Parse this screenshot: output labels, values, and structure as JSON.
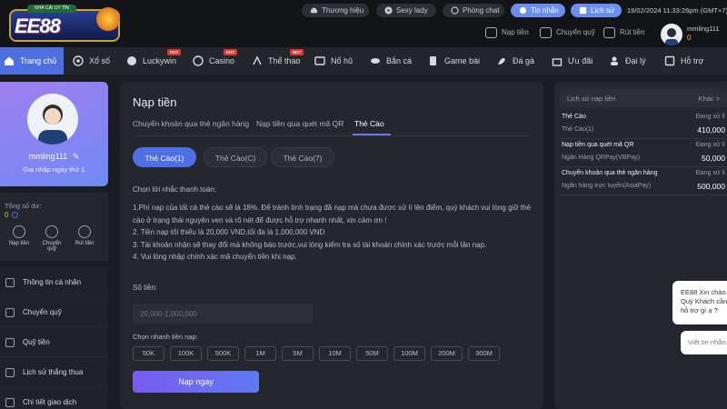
{
  "header": {
    "logo_text": "EE88",
    "logo_badge": "NHÀ CÁI UY TÍN",
    "pills": [
      {
        "label": "Thương hiệu",
        "icon": "car-icon"
      },
      {
        "label": "Sexy lady",
        "icon": "play-icon"
      },
      {
        "label": "Phòng chat",
        "icon": "chat-icon"
      },
      {
        "label": "Tin nhắn",
        "icon": "message-icon"
      },
      {
        "label": "Lịch sử",
        "icon": "history-icon"
      }
    ],
    "datetime": "19/02/2024 11:33:26pm (GMT+7)",
    "quick_actions": [
      {
        "label": "Nạp tiền",
        "icon": "deposit-icon"
      },
      {
        "label": "Chuyển quỹ",
        "icon": "wallet-icon"
      },
      {
        "label": "Rút tiền",
        "icon": "withdraw-icon"
      }
    ],
    "username": "mmling111",
    "balance": "0"
  },
  "nav": {
    "items": [
      {
        "label": "Trang chủ",
        "icon": "home-icon",
        "hot": false
      },
      {
        "label": "Xổ số",
        "icon": "lottery-icon",
        "hot": false
      },
      {
        "label": "Luckywin",
        "icon": "soccer-icon",
        "hot": true
      },
      {
        "label": "Casino",
        "icon": "casino-icon",
        "hot": true
      },
      {
        "label": "Thể thao",
        "icon": "sports-icon",
        "hot": true
      },
      {
        "label": "Nổ hũ",
        "icon": "slot-icon",
        "hot": false
      },
      {
        "label": "Bắn cá",
        "icon": "fish-icon",
        "hot": false
      },
      {
        "label": "Game bài",
        "icon": "cards-icon",
        "hot": false
      },
      {
        "label": "Đá gà",
        "icon": "rooster-icon",
        "hot": false
      },
      {
        "label": "Ưu đãi",
        "icon": "gift-icon",
        "hot": false
      },
      {
        "label": "Đại lý",
        "icon": "agent-icon",
        "hot": false
      },
      {
        "label": "Hỗ trợ",
        "icon": "support-icon",
        "hot": false
      }
    ],
    "hot_label": "HOT"
  },
  "sidebar": {
    "username": "mmling111",
    "rank": "Gia nhập ngày thứ 1",
    "wallet_label": "Tổng số dư:",
    "wallet_value": "0",
    "wallet_buttons": [
      {
        "label": "Nạp tiền",
        "icon": "deposit-icon"
      },
      {
        "label": "Chuyển quỹ",
        "icon": "wallet-icon"
      },
      {
        "label": "Rút tiền",
        "icon": "withdraw-icon"
      }
    ],
    "menu": [
      {
        "label": "Thông tin cá nhân",
        "icon": "user-icon"
      },
      {
        "label": "Chuyển quỹ",
        "icon": "transfer-icon"
      },
      {
        "label": "Quỹ tiền",
        "icon": "fund-icon"
      },
      {
        "label": "Lịch sử thắng thua",
        "icon": "chart-icon"
      },
      {
        "label": "Chi tiết giao dịch",
        "icon": "list-icon"
      }
    ]
  },
  "main": {
    "title": "Nạp tiền",
    "tabs": [
      {
        "label": "Chuyển khoản qua thẻ ngân hàng"
      },
      {
        "label": "Nạp tiền qua quét mã QR"
      },
      {
        "label": "Thẻ Cào"
      }
    ],
    "chips": [
      {
        "label": "Thẻ Cào(1)"
      },
      {
        "label": "Thẻ Cào(C)"
      },
      {
        "label": "Thẻ Cào(7)"
      }
    ],
    "notice_title": "Chọn lời nhắc thanh toán:",
    "notice_lines": [
      "1.Phí nạp của tất cả thẻ cào sẽ là 18%. Để tránh tình trạng đã nạp mà chưa được xử lí lên điểm, quý khách vui lòng giữ thẻ cào ở trạng thái nguyên ven và rõ nét  để được hỗ trợ nhanh nhất, xin cảm ơn !",
      "2. Tiền nạp tối thiểu là 20,000 VND,tối đa là 1,000,000 VND",
      "3. Tài khoản nhận sẽ thay đổi mà không báo trước,vui lòng kiểm tra số tài khoản chính xác trước mỗi lần nạp.",
      "4. Vui lòng nhập chính xác mã chuyển tiền khi nạp."
    ],
    "amount_label": "Số tiền:",
    "amount_placeholder": "20,000-1,000,000",
    "quick_label": "Chọn nhanh tiền nạp:",
    "quick_amounts": [
      "50K",
      "100K",
      "500K",
      "1M",
      "5M",
      "10M",
      "50M",
      "100M",
      "200M",
      "300M"
    ],
    "submit_label": "Nạp ngay"
  },
  "history": {
    "title": "Lịch sử nạp tiền",
    "more": "Khác >",
    "rows": [
      {
        "method": "Thẻ Cào",
        "status": "Đang xử lí",
        "channel": "Thẻ Cào(1)",
        "amount": "410,000"
      },
      {
        "method": "Nạp tiền qua quét mã QR",
        "status": "Đang xử lí",
        "channel": "Ngân Hàng QRPay(VBPay)",
        "amount": "50,000"
      },
      {
        "method": "Chuyển khoản qua thẻ ngân hàng",
        "status": "Đang xử lí",
        "channel": "Ngân hàng trực tuyến(AsiaPay)",
        "amount": "500,000"
      }
    ]
  },
  "chat": {
    "greeting": "EE88 Xin chào Quý Khách cần hỗ trợ gì ạ ?",
    "input_placeholder": "Viết tin nhắn..."
  },
  "colors": {
    "accent": "#4e6fe6",
    "balance": "#f5b324",
    "hot": "#e0382f"
  }
}
